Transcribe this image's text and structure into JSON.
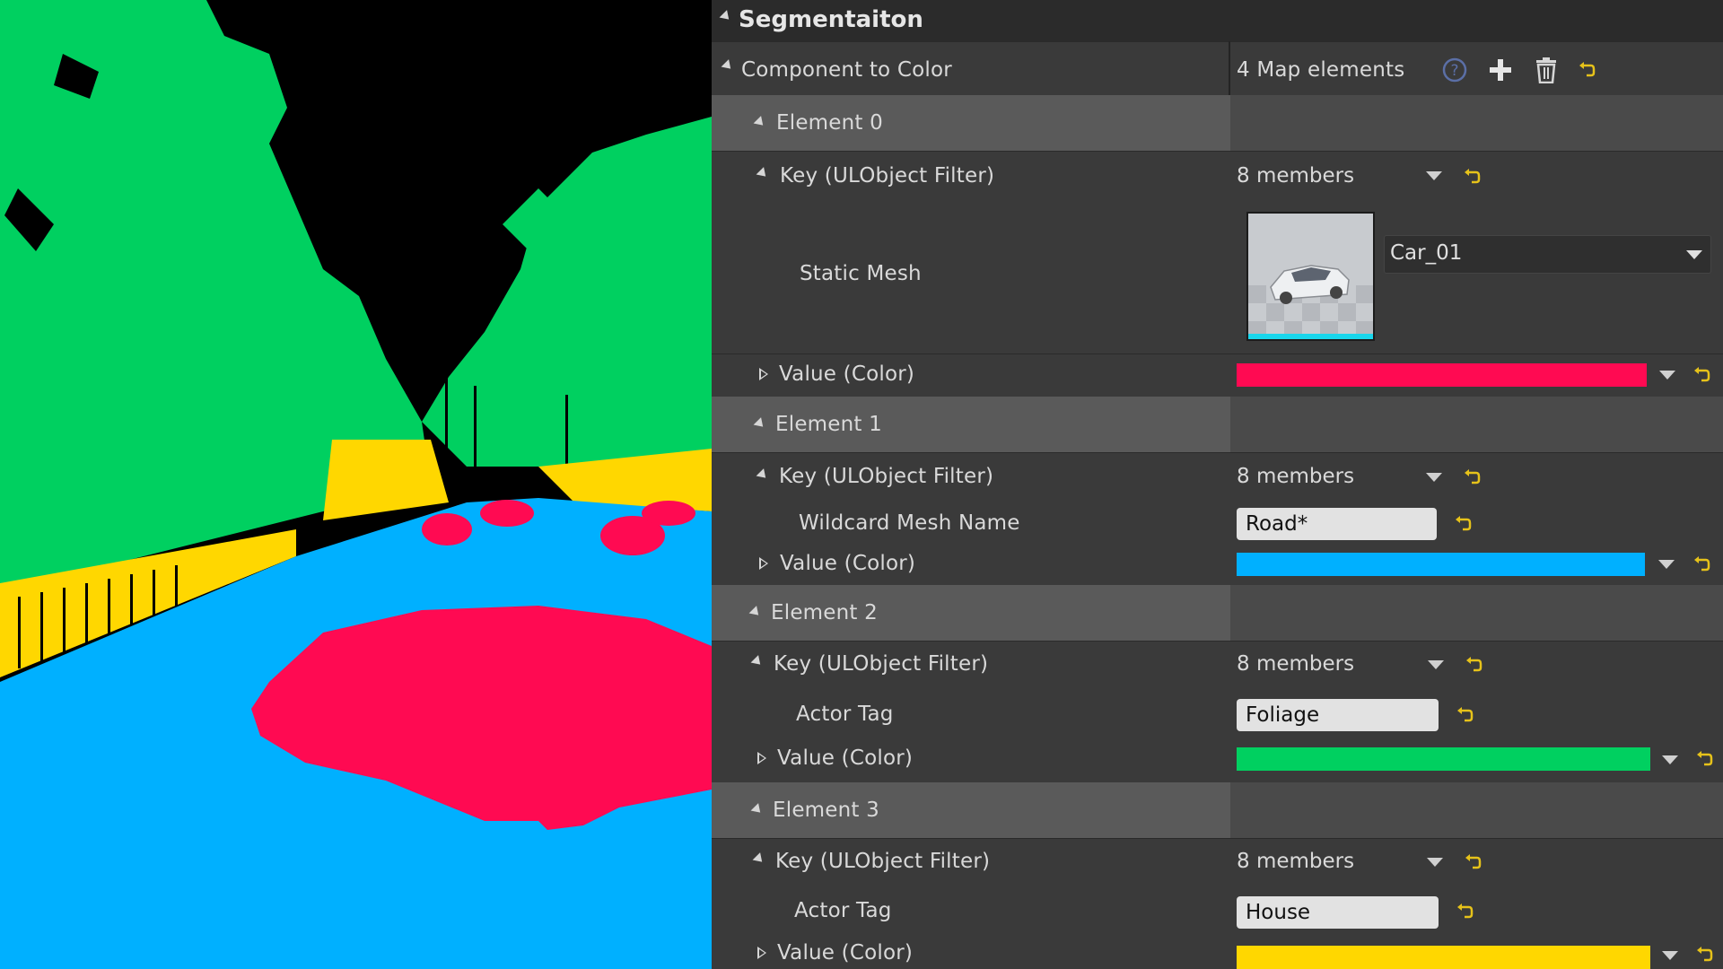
{
  "panel": {
    "section_title": "Segmentaiton",
    "property": {
      "label": "Component to Color",
      "count": "4 Map elements",
      "icons": [
        "help-icon",
        "add-icon",
        "trash-icon",
        "reset-icon"
      ]
    },
    "elements": [
      {
        "label": "Element 0",
        "key_label": "Key (ULObject Filter)",
        "key_members": "8 members",
        "filter_label": "Static Mesh",
        "mesh_asset": "Car_01",
        "value_label": "Value (Color)",
        "color": "#ff0a52"
      },
      {
        "label": "Element 1",
        "key_label": "Key (ULObject Filter)",
        "key_members": "8 members",
        "filter_label": "Wildcard Mesh Name",
        "filter_value": "Road*",
        "value_label": "Value (Color)",
        "color": "#00b0ff"
      },
      {
        "label": "Element 2",
        "key_label": "Key (ULObject Filter)",
        "key_members": "8 members",
        "filter_label": "Actor Tag",
        "filter_value": "Foliage",
        "value_label": "Value (Color)",
        "color": "#00d060"
      },
      {
        "label": "Element 3",
        "key_label": "Key (ULObject Filter)",
        "key_members": "8 members",
        "filter_label": "Actor Tag",
        "filter_value": "House",
        "value_label": "Value (Color)",
        "color": "#ffd700"
      }
    ]
  },
  "viewport": {
    "colors": {
      "sky": "#000000",
      "foliage": "#00d060",
      "road": "#00b0ff",
      "car": "#ff0a52",
      "house": "#ffd700"
    }
  }
}
